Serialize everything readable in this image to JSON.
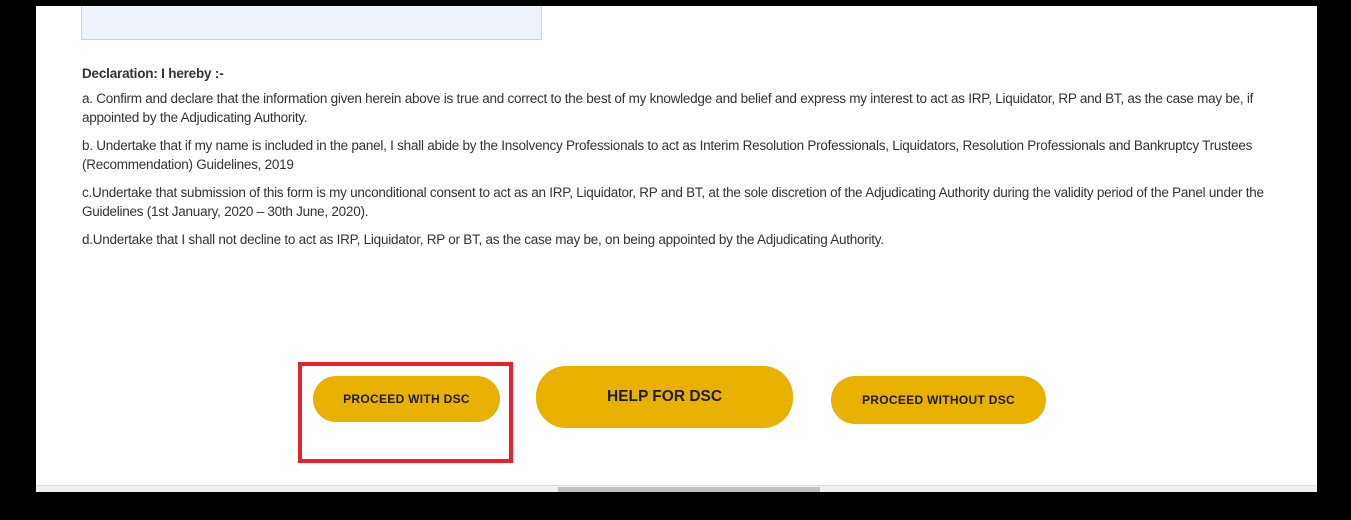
{
  "declaration": {
    "heading": "Declaration: I hereby :-",
    "items": [
      "a. Confirm and declare that the information given herein above is true and correct to the best of my knowledge and belief and express my interest to act as IRP, Liquidator, RP and BT, as the case may be, if appointed by the Adjudicating Authority.",
      "b. Undertake that if my name is included in the panel, I shall abide by the Insolvency Professionals to act as Interim Resolution Professionals, Liquidators, Resolution Professionals and Bankruptcy Trustees (Recommendation) Guidelines, 2019",
      "c.Undertake that submission of this form is my unconditional consent to act as an IRP, Liquidator, RP and BT, at the sole discretion of the Adjudicating Authority during the validity period of the Panel under the Guidelines (1st January, 2020 – 30th June, 2020).",
      "d.Undertake that I shall not decline to act as IRP, Liquidator, RP or BT, as the case may be, on being appointed by the Adjudicating Authority."
    ]
  },
  "actions": {
    "proceed_with_dsc": "PROCEED WITH DSC",
    "help_for_dsc": "HELP FOR DSC",
    "proceed_without_dsc": "PROCEED WITHOUT DSC"
  },
  "colors": {
    "button_background": "#e8b100",
    "highlight_border": "#e8222c",
    "text": "#333333",
    "frame": "#000000"
  }
}
